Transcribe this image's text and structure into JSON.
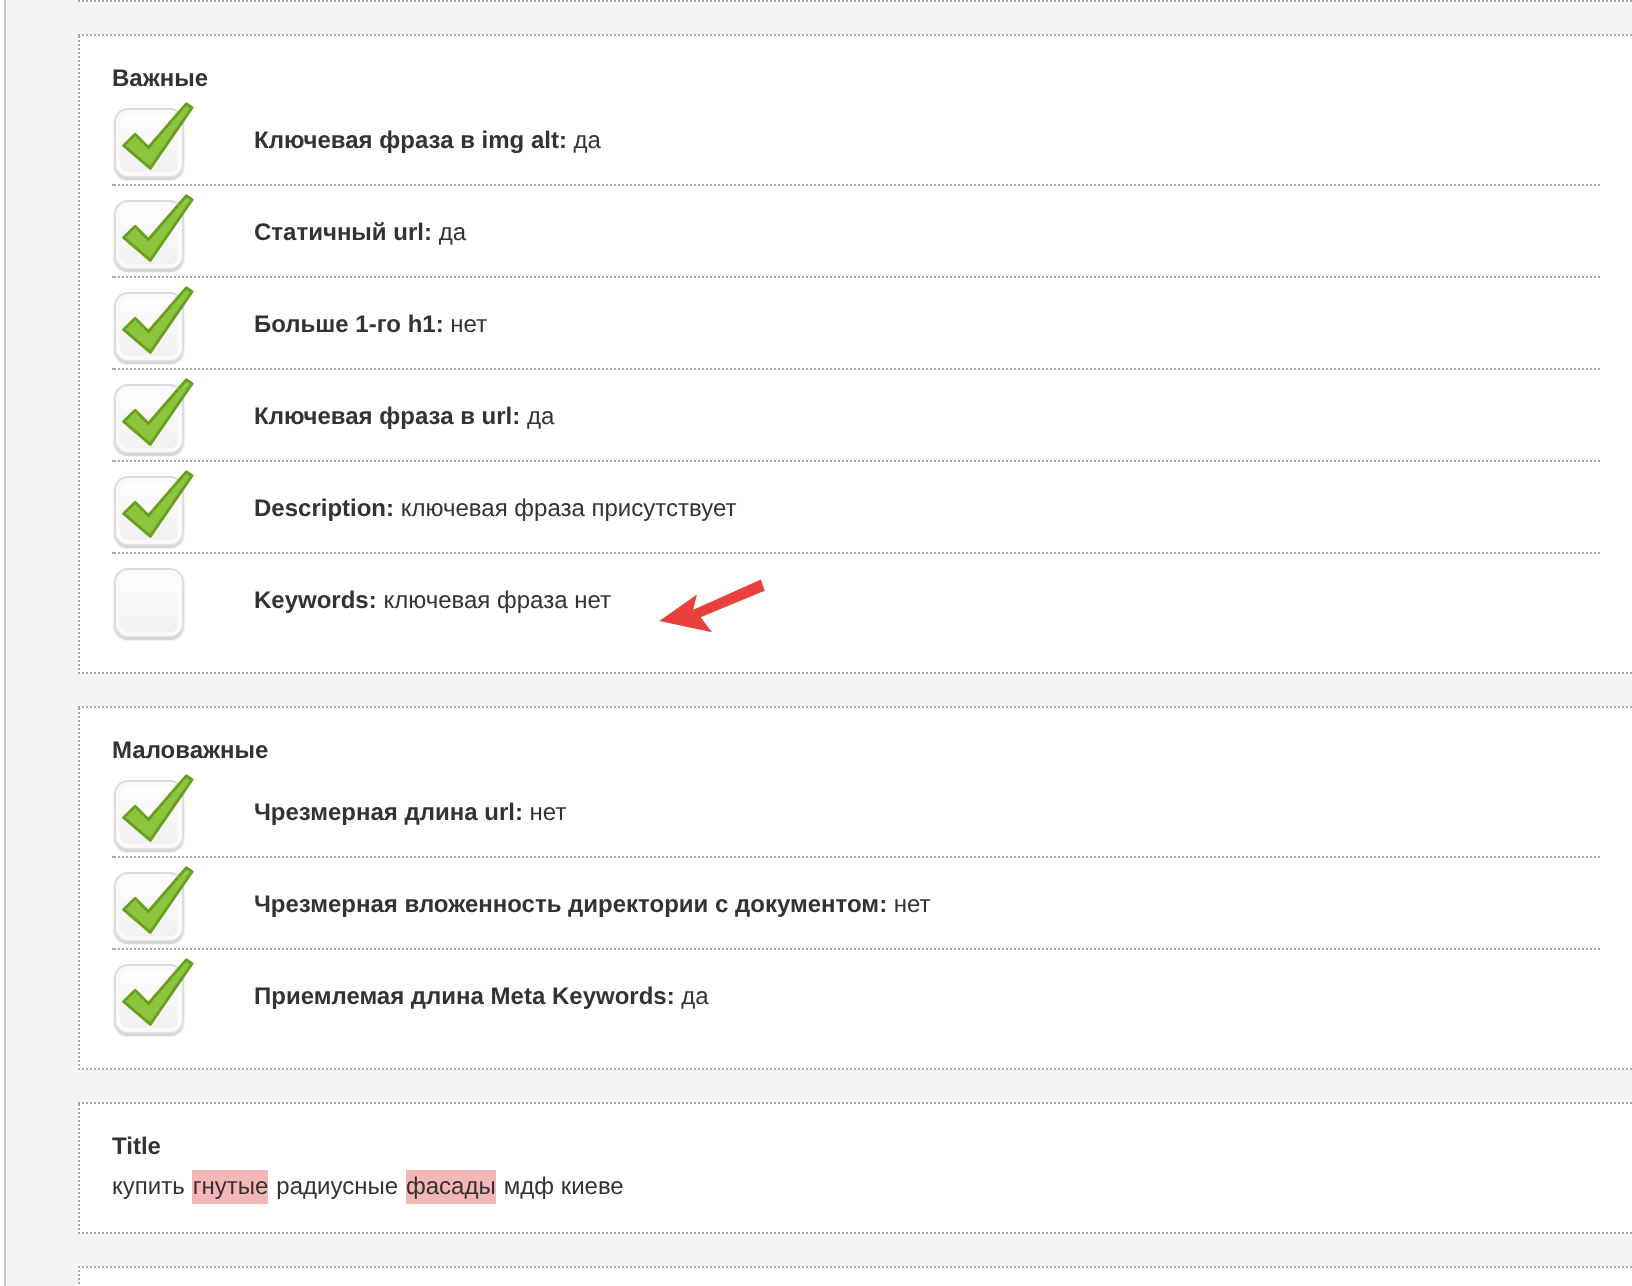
{
  "sections": [
    {
      "kind": "empty"
    },
    {
      "kind": "checklist",
      "heading": "Важные",
      "rows": [
        {
          "label": "Ключевая фраза в img alt:",
          "value": "да",
          "checked": true
        },
        {
          "label": "Статичный url:",
          "value": "да",
          "checked": true
        },
        {
          "label": "Больше 1-го h1:",
          "value": "нет",
          "checked": true
        },
        {
          "label": "Ключевая фраза в url:",
          "value": "да",
          "checked": true
        },
        {
          "label": "Description:",
          "value": "ключевая фраза присутствует",
          "checked": true
        },
        {
          "label": "Keywords:",
          "value": "ключевая фраза нет",
          "checked": false,
          "annotated": true
        }
      ]
    },
    {
      "kind": "checklist",
      "heading": "Маловажные",
      "rows": [
        {
          "label": "Чрезмерная длина url:",
          "value": "нет",
          "checked": true
        },
        {
          "label": "Чрезмерная вложенность директории с документом:",
          "value": "нет",
          "checked": true
        },
        {
          "label": "Приемлемая длина Meta Keywords:",
          "value": "да",
          "checked": true
        }
      ]
    },
    {
      "kind": "text",
      "heading": "Title",
      "segments": [
        {
          "text": "купить",
          "highlighted": false
        },
        {
          "text": "гнутые",
          "highlighted": true
        },
        {
          "text": "радиусные",
          "highlighted": false
        },
        {
          "text": "фасады",
          "highlighted": true
        },
        {
          "text": "мдф киеве",
          "highlighted": false
        }
      ]
    },
    {
      "kind": "empty"
    }
  ]
}
